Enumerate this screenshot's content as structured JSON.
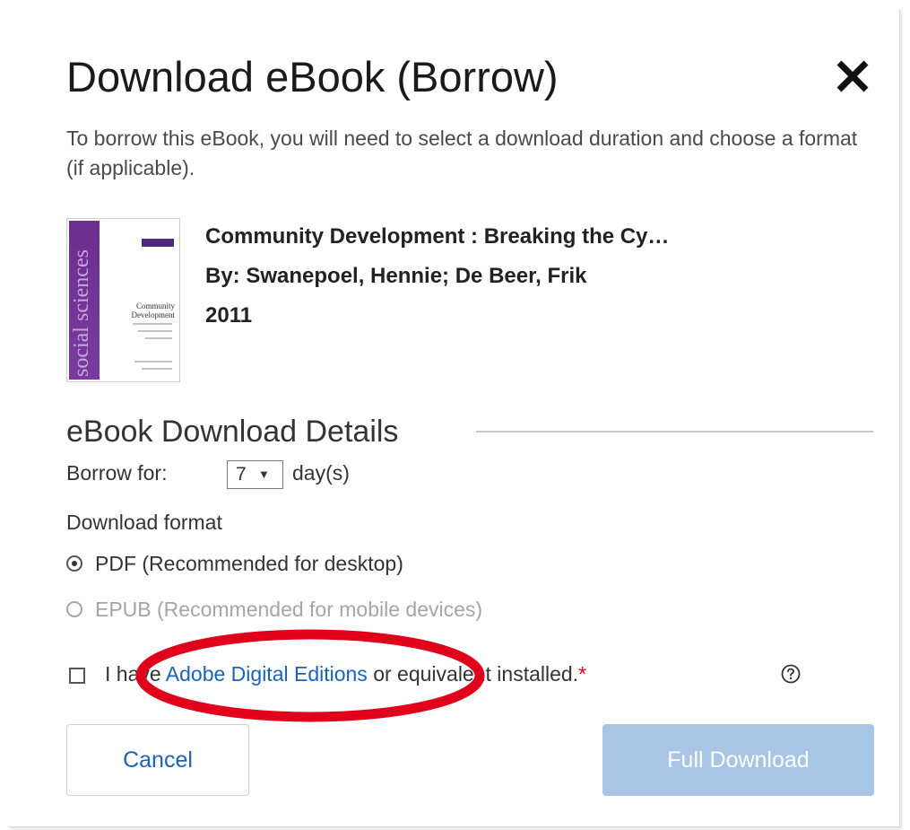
{
  "dialog": {
    "title": "Download eBook (Borrow)",
    "close_icon": "close-icon",
    "intro": "To borrow this eBook, you will need to select a download duration and choose a format (if applicable)."
  },
  "book": {
    "cover_text": "social sciences",
    "cover_title": "Community Development",
    "title": "Community Development : Breaking the Cy…",
    "authors": "By: Swanepoel, Hennie; De Beer, Frik",
    "year": "2011"
  },
  "details": {
    "section_title": "eBook Download Details",
    "borrow_label": "Borrow for:",
    "borrow_value": "7",
    "borrow_arrow": "▼",
    "days_label": "day(s)",
    "format_label": "Download format",
    "formats": [
      {
        "label": "PDF (Recommended for desktop)",
        "selected": true,
        "enabled": true
      },
      {
        "label": "EPUB (Recommended for mobile devices)",
        "selected": false,
        "enabled": false
      }
    ],
    "agree_prefix": "I have ",
    "agree_link": "Adobe Digital Editions",
    "agree_suffix": " or equivalent installed.",
    "required_mark": "*",
    "help_icon": "help-icon"
  },
  "actions": {
    "cancel_label": "Cancel",
    "download_label": "Full Download",
    "download_enabled": false
  },
  "colors": {
    "link": "#1b63b8",
    "required": "#d9001b",
    "download_disabled_bg": "#a8c5e6",
    "annotation": "#e0001b",
    "cover_stripe": "#6b2d8e"
  }
}
